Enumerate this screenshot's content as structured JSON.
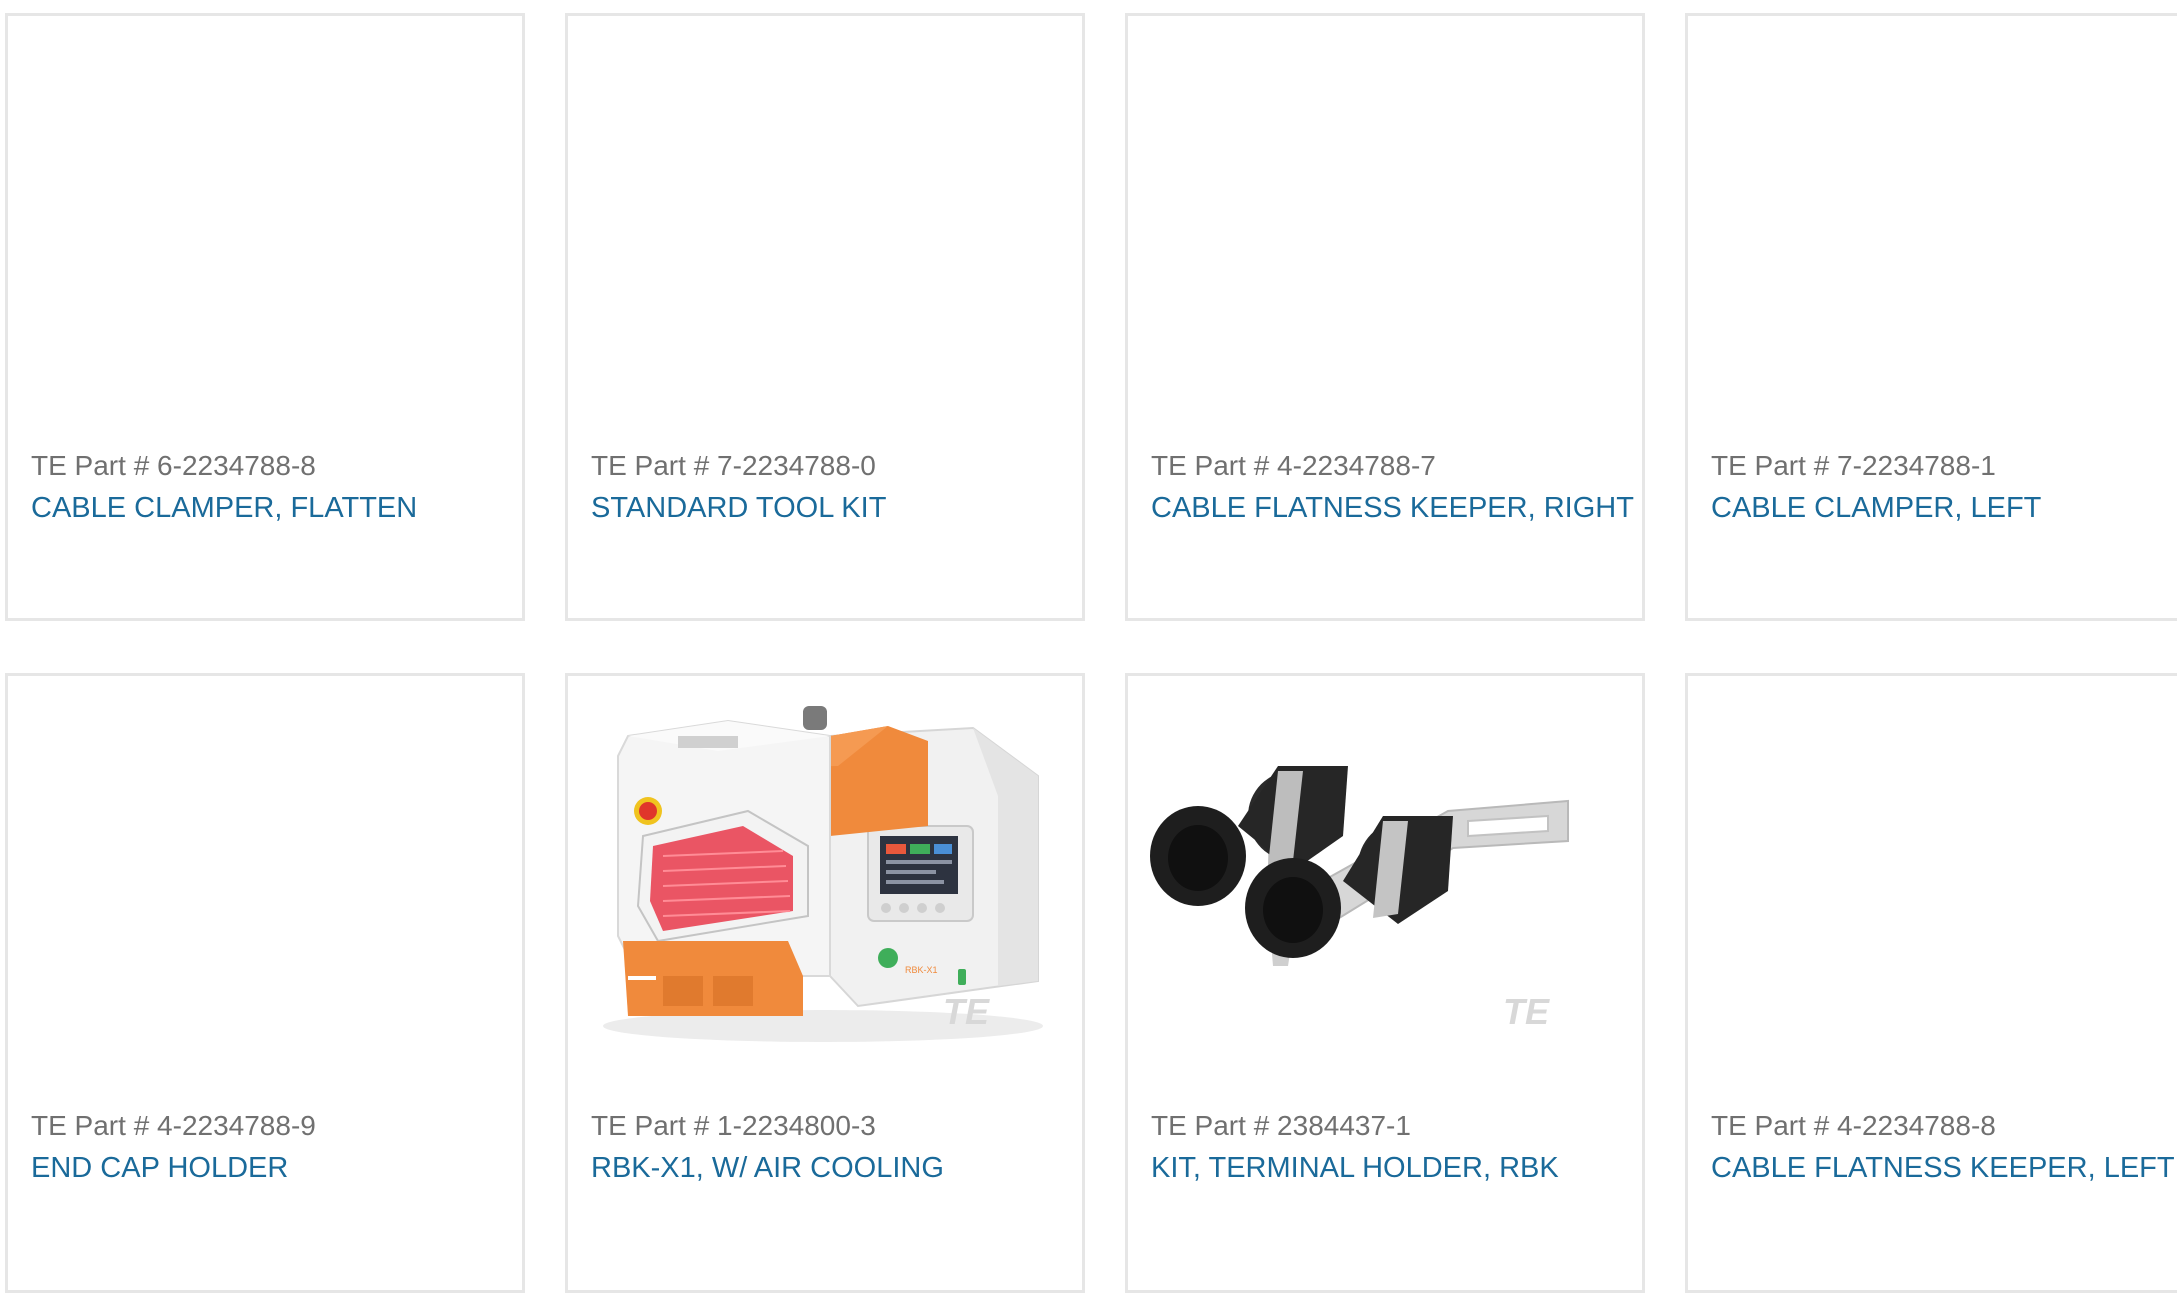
{
  "products": [
    {
      "part_prefix": "TE Part # ",
      "part_number": "6-2234788-8",
      "title": "CABLE CLAMPER, FLATTEN",
      "image": "none"
    },
    {
      "part_prefix": "TE Part # ",
      "part_number": "7-2234788-0",
      "title": "STANDARD TOOL KIT",
      "image": "none"
    },
    {
      "part_prefix": "TE Part # ",
      "part_number": "4-2234788-7",
      "title": "CABLE FLATNESS KEEPER, RIGHT",
      "image": "none"
    },
    {
      "part_prefix": "TE Part # ",
      "part_number": "7-2234788-1",
      "title": "CABLE CLAMPER, LEFT",
      "image": "none"
    },
    {
      "part_prefix": "TE Part # ",
      "part_number": "4-2234788-9",
      "title": "END CAP HOLDER",
      "image": "none"
    },
    {
      "part_prefix": "TE Part # ",
      "part_number": "1-2234800-3",
      "title": "RBK-X1, W/ AIR COOLING",
      "image": "machine-photo"
    },
    {
      "part_prefix": "TE Part # ",
      "part_number": "2384437-1",
      "title": "KIT, TERMINAL HOLDER, RBK",
      "image": "terminal-holder-photo"
    },
    {
      "part_prefix": "TE Part # ",
      "part_number": "4-2234788-8",
      "title": "CABLE FLATNESS KEEPER, LEFT",
      "image": "none"
    }
  ],
  "watermark": "TE",
  "machine_label": "RBK-X1",
  "colors": {
    "link": "#1a6a9a",
    "part_number": "#707070",
    "card_border": "#e6e6e6",
    "machine_orange": "#f08a3c"
  }
}
